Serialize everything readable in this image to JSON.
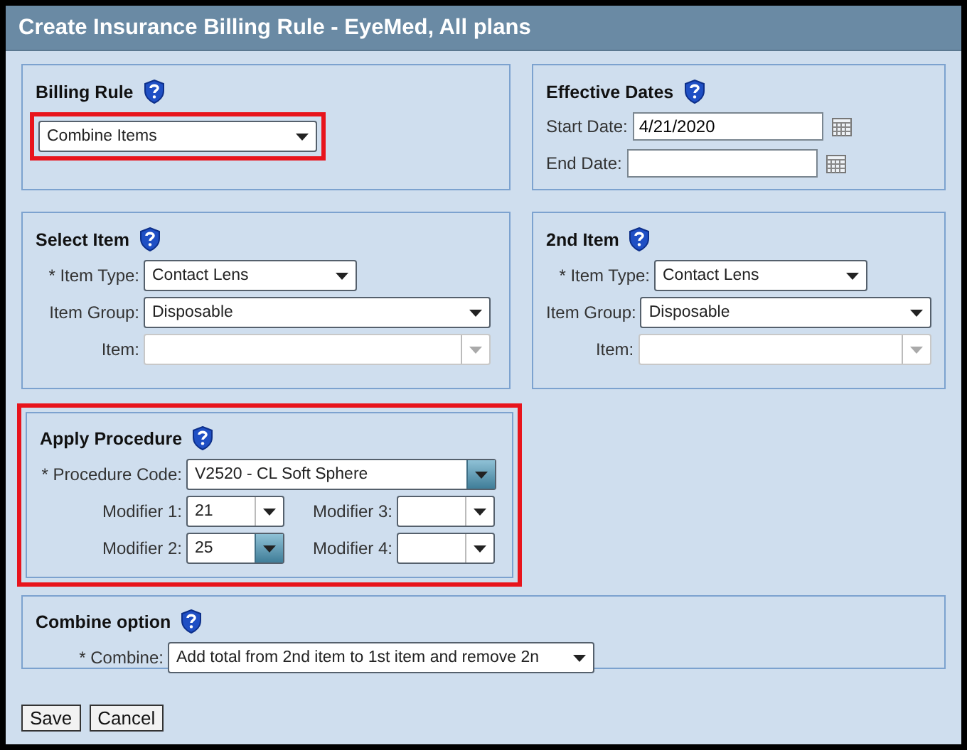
{
  "window": {
    "title": "Create Insurance Billing Rule - EyeMed, All plans"
  },
  "billing_rule": {
    "title": "Billing Rule",
    "field": {
      "kind": "select",
      "value": "Combine Items",
      "disabled": false,
      "active": false
    },
    "highlighted": true
  },
  "effective_dates": {
    "title": "Effective Dates",
    "fields": [
      {
        "label": "Start Date:",
        "value": "4/21/2020"
      },
      {
        "label": "End Date:"
      }
    ]
  },
  "select_item": {
    "title": "Select Item",
    "fields": [
      {
        "label": "* Item Type:",
        "kind": "select",
        "value": "Contact Lens",
        "disabled": false,
        "active": false
      },
      {
        "label": "Item Group:",
        "kind": "select",
        "value": "Disposable",
        "disabled": false,
        "active": false
      },
      {
        "label": "Item:",
        "kind": "combo",
        "disabled": true,
        "active": false
      }
    ]
  },
  "second_item": {
    "title": "2nd Item",
    "fields": [
      {
        "label": "* Item Type:",
        "kind": "select",
        "value": "Contact Lens",
        "disabled": false,
        "active": false
      },
      {
        "label": "Item Group:",
        "kind": "select",
        "value": "Disposable",
        "disabled": false,
        "active": false
      },
      {
        "label": "Item:",
        "kind": "combo",
        "disabled": true,
        "active": false
      }
    ]
  },
  "apply_procedure": {
    "title": "Apply Procedure",
    "highlighted": true,
    "procedure": {
      "label": "* Procedure Code:",
      "kind": "combo",
      "value": "V2520 - CL Soft Sphere",
      "disabled": false,
      "active": true
    },
    "modifiers": [
      {
        "label": "Modifier 1:",
        "kind": "combo",
        "value": "21",
        "disabled": false,
        "active": false
      },
      {
        "label": "Modifier 3:",
        "kind": "combo",
        "disabled": false,
        "active": false
      },
      {
        "label": "Modifier 2:",
        "kind": "combo",
        "value": "25",
        "disabled": false,
        "active": true
      },
      {
        "label": "Modifier 4:",
        "kind": "combo",
        "disabled": false,
        "active": false
      }
    ]
  },
  "combine_option": {
    "title": "Combine option",
    "field": {
      "label": "* Combine:",
      "kind": "select",
      "value": "Add total from 2nd item to 1st item and remove 2n",
      "disabled": false,
      "active": false
    }
  },
  "buttons": [
    "Save",
    "Cancel"
  ]
}
